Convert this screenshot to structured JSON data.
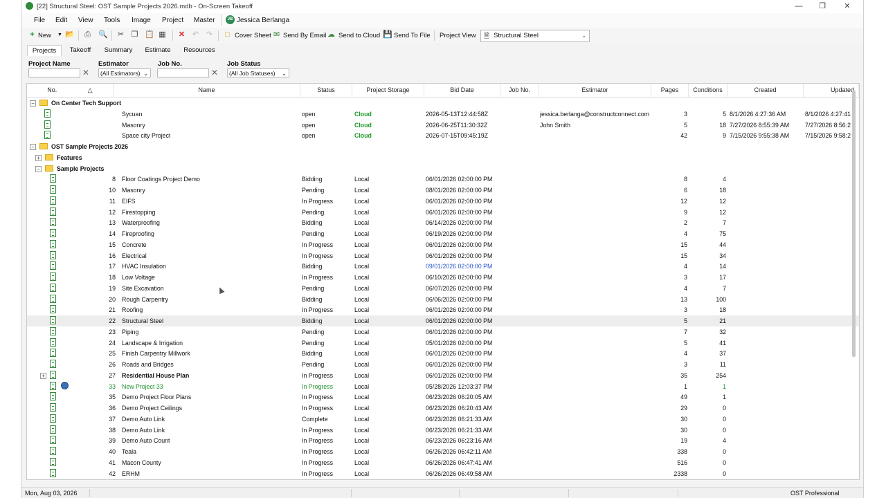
{
  "window": {
    "title": "[22] Structural Steel: OST Sample Projects 2026.mdb - On-Screen Takeoff"
  },
  "menu": [
    "File",
    "Edit",
    "View",
    "Tools",
    "Image",
    "Project",
    "Master"
  ],
  "user": {
    "initials": "JB",
    "name": "Jessica Berlanga"
  },
  "toolbar": {
    "new": "New",
    "cover_sheet": "Cover Sheet",
    "send_email": "Send By Email",
    "send_cloud": "Send to Cloud",
    "send_file": "Send To File",
    "project_view_label": "Project View",
    "project_view_value": "Structural Steel"
  },
  "tabs": [
    "Projects",
    "Takeoff",
    "Summary",
    "Estimate",
    "Resources"
  ],
  "filters": {
    "project_name": "Project Name",
    "estimator": "Estimator",
    "estimator_value": "(All Estimators)",
    "job_no": "Job No.",
    "job_status": "Job Status",
    "job_status_value": "(All Job Statuses)"
  },
  "columns": [
    "No.",
    "Name",
    "Status",
    "Project Storage",
    "Bid Date",
    "Job No.",
    "Estimator",
    "Pages",
    "Conditions",
    "Created",
    "Updated"
  ],
  "groups": {
    "oncenter": "On Center Tech Support",
    "ost": "OST Sample Projects 2026",
    "features": "Features",
    "sample": "Sample Projects"
  },
  "cloud_rows": [
    {
      "name": "Sycuan",
      "status": "open",
      "storage": "Cloud",
      "bid": "2026-05-13T12:44:58Z",
      "est": "jessica.berlanga@constructconnect.com",
      "pages": "3",
      "cond": "5",
      "created": "8/1/2026 4:27:36 AM",
      "updated": "8/1/2026 4:27:41"
    },
    {
      "name": "Masonry",
      "status": "open",
      "storage": "Cloud",
      "bid": "2026-06-25T11:30:32Z",
      "est": "John  Smith",
      "pages": "5",
      "cond": "18",
      "created": "7/27/2026 8:55:39 AM",
      "updated": "7/27/2026 8:56:2"
    },
    {
      "name": "Space city Project",
      "status": "open",
      "storage": "Cloud",
      "bid": "2026-07-15T09:45:19Z",
      "est": "",
      "pages": "42",
      "cond": "9",
      "created": "7/15/2026 9:55:38 AM",
      "updated": "7/15/2026 9:58:2"
    }
  ],
  "local_rows": [
    {
      "no": "8",
      "name": "Floor Coatings Project Demo",
      "status": "Bidding",
      "storage": "Local",
      "bid": "06/01/2026 02:00:00 PM",
      "pages": "8",
      "cond": "4"
    },
    {
      "no": "10",
      "name": "Masonry",
      "status": "Pending",
      "storage": "Local",
      "bid": "08/01/2026 02:00:00 PM",
      "pages": "6",
      "cond": "18"
    },
    {
      "no": "11",
      "name": "EIFS",
      "status": "In Progress",
      "storage": "Local",
      "bid": "06/01/2026 02:00:00 PM",
      "pages": "12",
      "cond": "12"
    },
    {
      "no": "12",
      "name": "Firestopping",
      "status": "Pending",
      "storage": "Local",
      "bid": "06/01/2026 02:00:00 PM",
      "pages": "9",
      "cond": "12"
    },
    {
      "no": "13",
      "name": "Waterproofing",
      "status": "Bidding",
      "storage": "Local",
      "bid": "06/14/2026 02:00:00 PM",
      "pages": "2",
      "cond": "7"
    },
    {
      "no": "14",
      "name": "Fireproofing",
      "status": "Pending",
      "storage": "Local",
      "bid": "06/19/2026 02:00:00 PM",
      "pages": "4",
      "cond": "75"
    },
    {
      "no": "15",
      "name": "Concrete",
      "status": "In Progress",
      "storage": "Local",
      "bid": "06/01/2026 02:00:00 PM",
      "pages": "15",
      "cond": "44"
    },
    {
      "no": "16",
      "name": "Electrical",
      "status": "In Progress",
      "storage": "Local",
      "bid": "06/01/2026 02:00:00 PM",
      "pages": "15",
      "cond": "34"
    },
    {
      "no": "17",
      "name": "HVAC Insulation",
      "status": "Bidding",
      "storage": "Local",
      "bid": "09/01/2026 02:00:00 PM",
      "pages": "4",
      "cond": "14",
      "bid_blue": true
    },
    {
      "no": "18",
      "name": "Low Voltage",
      "status": "In Progress",
      "storage": "Local",
      "bid": "06/10/2026 02:00:00 PM",
      "pages": "3",
      "cond": "17"
    },
    {
      "no": "19",
      "name": "Site Excavation",
      "status": "Pending",
      "storage": "Local",
      "bid": "06/07/2026 02:00:00 PM",
      "pages": "4",
      "cond": "7"
    },
    {
      "no": "20",
      "name": "Rough Carpentry",
      "status": "Bidding",
      "storage": "Local",
      "bid": "06/06/2026 02:00:00 PM",
      "pages": "13",
      "cond": "100"
    },
    {
      "no": "21",
      "name": "Roofing",
      "status": "In Progress",
      "storage": "Local",
      "bid": "06/01/2026 02:00:00 PM",
      "pages": "3",
      "cond": "18"
    },
    {
      "no": "22",
      "name": "Structural Steel",
      "status": "Bidding",
      "storage": "Local",
      "bid": "06/01/2026 02:00:00 PM",
      "pages": "5",
      "cond": "21",
      "selected": true
    },
    {
      "no": "23",
      "name": "Piping",
      "status": "Pending",
      "storage": "Local",
      "bid": "06/01/2026 02:00:00 PM",
      "pages": "7",
      "cond": "32"
    },
    {
      "no": "24",
      "name": "Landscape & Irrigation",
      "status": "Pending",
      "storage": "Local",
      "bid": "05/01/2026 02:00:00 PM",
      "pages": "5",
      "cond": "41"
    },
    {
      "no": "25",
      "name": "Finish Carpentry  Millwork",
      "status": "Bidding",
      "storage": "Local",
      "bid": "06/01/2026 02:00:00 PM",
      "pages": "4",
      "cond": "37"
    },
    {
      "no": "26",
      "name": "Roads and Bridges",
      "status": "Pending",
      "storage": "Local",
      "bid": "06/01/2026 02:00:00 PM",
      "pages": "3",
      "cond": "11"
    },
    {
      "no": "27",
      "name": "Residential House Plan",
      "status": "In Progress",
      "storage": "Local",
      "bid": "06/01/2026 02:00:00 PM",
      "pages": "35",
      "cond": "254",
      "bold": true,
      "expand": true
    },
    {
      "no": "33",
      "name": "New Project 33",
      "status": "In Progress",
      "storage": "Local",
      "bid": "05/28/2026 12:03:37 PM",
      "pages": "1",
      "cond": "1",
      "green": true,
      "globe": true
    },
    {
      "no": "35",
      "name": "Demo Project Floor Plans",
      "status": "In Progress",
      "storage": "Local",
      "bid": "06/23/2026 06:20:05 AM",
      "pages": "49",
      "cond": "1"
    },
    {
      "no": "36",
      "name": "Demo Project Ceilings",
      "status": "In Progress",
      "storage": "Local",
      "bid": "06/23/2026 06:20:43 AM",
      "pages": "29",
      "cond": "0"
    },
    {
      "no": "37",
      "name": "Demo Auto Link",
      "status": "Complete",
      "storage": "Local",
      "bid": "06/23/2026 06:21:33 AM",
      "pages": "30",
      "cond": "0"
    },
    {
      "no": "38",
      "name": "Demo Auto Link",
      "status": "In Progress",
      "storage": "Local",
      "bid": "06/23/2026 06:21:33 AM",
      "pages": "30",
      "cond": "0"
    },
    {
      "no": "39",
      "name": "Demo Auto Count",
      "status": "In Progress",
      "storage": "Local",
      "bid": "06/23/2026 06:23:16 AM",
      "pages": "19",
      "cond": "4"
    },
    {
      "no": "40",
      "name": "Teala",
      "status": "In Progress",
      "storage": "Local",
      "bid": "06/26/2026 06:42:11 AM",
      "pages": "338",
      "cond": "0"
    },
    {
      "no": "41",
      "name": "Macon County",
      "status": "In Progress",
      "storage": "Local",
      "bid": "06/26/2026 06:47:41 AM",
      "pages": "516",
      "cond": "0"
    },
    {
      "no": "42",
      "name": "ERHM",
      "status": "In Progress",
      "storage": "Local",
      "bid": "06/26/2026 06:49:58 AM",
      "pages": "2338",
      "cond": "0"
    }
  ],
  "statusbar": {
    "date": "Mon, Aug 03, 2026",
    "edition": "OST Professional"
  }
}
